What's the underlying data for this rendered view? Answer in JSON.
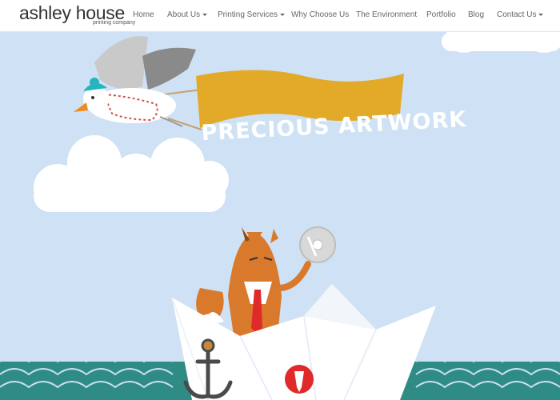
{
  "brand": {
    "name": "ashley house",
    "tagline": "printing company"
  },
  "nav": {
    "items": [
      {
        "label": "Home",
        "has_dropdown": false
      },
      {
        "label": "About Us",
        "has_dropdown": true
      },
      {
        "label": "Printing Services",
        "has_dropdown": true
      },
      {
        "label": "Why Choose Us",
        "has_dropdown": false
      },
      {
        "label": "The Environment",
        "has_dropdown": false
      },
      {
        "label": "Portfolio",
        "has_dropdown": false
      },
      {
        "label": "Blog",
        "has_dropdown": false
      },
      {
        "label": "Contact Us",
        "has_dropdown": true
      }
    ]
  },
  "hero": {
    "banner_text": "PRECIOUS ARTWORK",
    "colors": {
      "sky": "#cfe1f4",
      "banner": "#e3aa2a",
      "waves": "#2f8c85",
      "fox": "#d9792c",
      "tie": "#e02a2a"
    }
  },
  "icons": {
    "seagull": "seagull-illustration",
    "fox": "fox-illustration",
    "boat": "paper-boat-illustration",
    "anchor": "anchor-icon",
    "cd": "cd-disc-icon",
    "badge": "pen-nib-badge-icon"
  }
}
